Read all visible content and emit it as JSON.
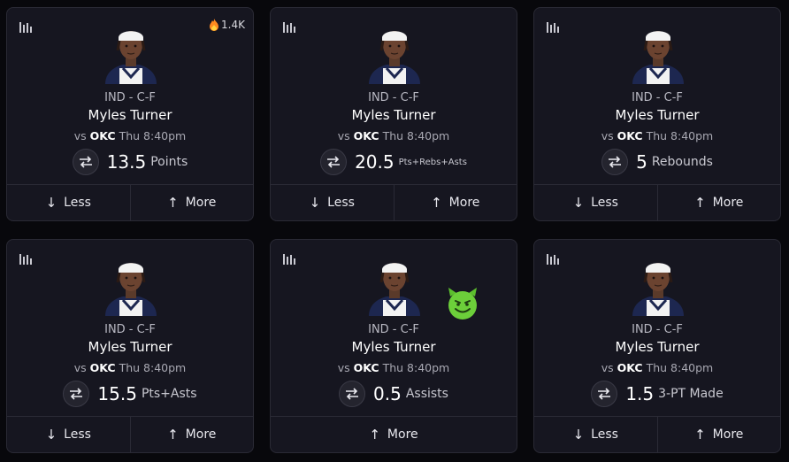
{
  "cards": [
    {
      "team_pos": "IND - C-F",
      "player": "Myles Turner",
      "opp_prefix": "vs",
      "opponent": "OKC",
      "game_time": "Thu 8:40pm",
      "line": "13.5",
      "stat": "Points",
      "trend": "1.4K",
      "less_label": "Less",
      "more_label": "More"
    },
    {
      "team_pos": "IND - C-F",
      "player": "Myles Turner",
      "opp_prefix": "vs",
      "opponent": "OKC",
      "game_time": "Thu 8:40pm",
      "line": "20.5",
      "stat": "Pts+Rebs+Asts",
      "less_label": "Less",
      "more_label": "More"
    },
    {
      "team_pos": "IND - C-F",
      "player": "Myles Turner",
      "opp_prefix": "vs",
      "opponent": "OKC",
      "game_time": "Thu 8:40pm",
      "line": "5",
      "stat": "Rebounds",
      "less_label": "Less",
      "more_label": "More"
    },
    {
      "team_pos": "IND - C-F",
      "player": "Myles Turner",
      "opp_prefix": "vs",
      "opponent": "OKC",
      "game_time": "Thu 8:40pm",
      "line": "15.5",
      "stat": "Pts+Asts",
      "less_label": "Less",
      "more_label": "More"
    },
    {
      "team_pos": "IND - C-F",
      "player": "Myles Turner",
      "opp_prefix": "vs",
      "opponent": "OKC",
      "game_time": "Thu 8:40pm",
      "line": "0.5",
      "stat": "Assists",
      "more_label": "More",
      "badge": "devil-emoji"
    },
    {
      "team_pos": "IND - C-F",
      "player": "Myles Turner",
      "opp_prefix": "vs",
      "opponent": "OKC",
      "game_time": "Thu 8:40pm",
      "line": "1.5",
      "stat": "3-PT Made",
      "less_label": "Less",
      "more_label": "More"
    }
  ],
  "colors": {
    "background": "#08080c",
    "card": "#161620",
    "border": "#2a2a35",
    "jersey": "#1d2750",
    "fire": "#ff8a1f",
    "devil": "#6ccf3a"
  },
  "icons": {
    "stats": "bar-chart-icon",
    "trend": "fire-icon",
    "swap": "swap-arrows-icon",
    "less": "arrow-down-icon",
    "more": "arrow-up-icon"
  }
}
